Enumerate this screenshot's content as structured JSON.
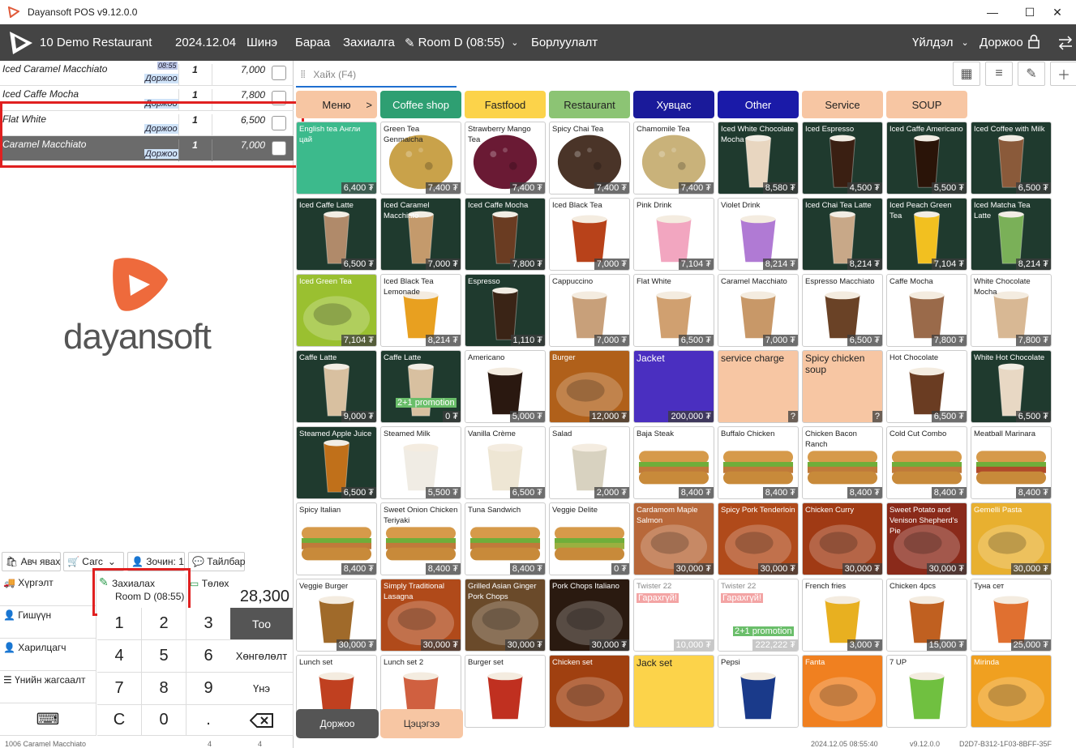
{
  "window": {
    "title": "Dayansoft POS v9.12.0.0"
  },
  "appbar": {
    "restaurant": "10 Demo Restaurant",
    "date": "2024.12.04",
    "new": "Шинэ",
    "goods": "Бараа",
    "orders": "Захиалга",
    "room": "Room D (08:55)",
    "sales": "Борлуулалт",
    "operations": "Үйлдэл",
    "template": "Доржоо"
  },
  "order_lines": [
    {
      "name": "Iced Caramel Macchiato",
      "time": "08:55",
      "staff": "Доржоо",
      "qty": "1",
      "price": "7,000"
    },
    {
      "name": "Iced Caffe Mocha",
      "staff": "Доржоо",
      "qty": "1",
      "price": "7,800"
    },
    {
      "name": "Flat White",
      "staff": "Доржоо",
      "qty": "1",
      "price": "6,500"
    },
    {
      "name": "Caramel Macchiato",
      "staff": "Доржоо",
      "qty": "1",
      "price": "7,000"
    }
  ],
  "brand": {
    "wordmark": "dayansoft"
  },
  "actions": {
    "takeaway": "Авч явах",
    "table": "Сагс",
    "guests": "Зочин: 1",
    "note": "Тайлбар"
  },
  "panel": {
    "delivery": "Хүргэлт",
    "order": "Захиалах",
    "order_room": "Room D (08:55)",
    "payment": "Төлөх",
    "total": "28,300",
    "member": "Гишүүн",
    "customer": "Харилцагч",
    "price_discount": "Үнийн жагсаалт",
    "qty": "Тоо",
    "discount": "Хөнгөлөлт",
    "price": "Үнэ"
  },
  "keypad": [
    "1",
    "2",
    "3",
    "4",
    "5",
    "6",
    "7",
    "8",
    "9",
    "C",
    "0",
    "."
  ],
  "search": {
    "placeholder": "Хайх (F4)"
  },
  "categories": [
    {
      "label": "Меню",
      "color": "#f7c6a3"
    },
    {
      "label": "Coffee shop",
      "color": "#2e9f72"
    },
    {
      "label": "Fastfood",
      "color": "#fcd34a"
    },
    {
      "label": "Restaurant",
      "color": "#8cc474"
    },
    {
      "label": "Хувцас",
      "color": "#1a1a9a"
    },
    {
      "label": "Other",
      "color": "#1a1aa8"
    },
    {
      "label": "Service",
      "color": "#f7c6a3"
    },
    {
      "label": "SOUP",
      "color": "#f7c6a3"
    }
  ],
  "tiles": [
    [
      {
        "name": "English tea Англи цай",
        "price": "6,400 ₮",
        "bg": "#3cba8c",
        "kind": "solid"
      },
      {
        "name": "Green Tea Genmaicha",
        "price": "7,400 ₮",
        "bg": "#c9a24a",
        "kind": "tea"
      },
      {
        "name": "Strawberry Mango Tea",
        "price": "7,400 ₮",
        "bg": "#6a1a34",
        "kind": "tea"
      },
      {
        "name": "Spicy Chai Tea",
        "price": "7,400 ₮",
        "bg": "#4a3428",
        "kind": "tea"
      },
      {
        "name": "Chamomile Tea",
        "price": "7,400 ₮",
        "bg": "#c9b27a",
        "kind": "tea"
      },
      {
        "name": "Iced White Chocolate Mocha",
        "price": "8,580 ₮",
        "bg": "#e8d6c0",
        "kind": "iced"
      },
      {
        "name": "Iced Espresso",
        "price": "4,500 ₮",
        "bg": "#3a1f12",
        "kind": "iced"
      },
      {
        "name": "Iced Caffe Americano",
        "price": "5,500 ₮",
        "bg": "#2a1408",
        "kind": "iced"
      },
      {
        "name": "Iced Coffee with Milk",
        "price": "6,500 ₮",
        "bg": "#8a5a3a",
        "kind": "iced"
      }
    ],
    [
      {
        "name": "Iced Caffe Latte",
        "price": "6,500 ₮",
        "bg": "#b08a6a",
        "kind": "iced"
      },
      {
        "name": "Iced Caramel Macchiato",
        "price": "7,000 ₮",
        "bg": "#c49a6c",
        "kind": "iced"
      },
      {
        "name": "Iced Caffe Mocha",
        "price": "7,800 ₮",
        "bg": "#6a3c22",
        "kind": "iced"
      },
      {
        "name": "Iced Black Tea",
        "price": "7,000 ₮",
        "bg": "#b8421a",
        "kind": "white"
      },
      {
        "name": "Pink Drink",
        "price": "7,104 ₮",
        "bg": "#f2a6c0",
        "kind": "white"
      },
      {
        "name": "Violet Drink",
        "price": "8,214 ₮",
        "bg": "#b07ad4",
        "kind": "white"
      },
      {
        "name": "Iced Chai Tea Latte",
        "price": "8,214 ₮",
        "bg": "#c8a888",
        "kind": "iced"
      },
      {
        "name": "Iced Peach Green Tea",
        "price": "7,104 ₮",
        "bg": "#f2c020",
        "kind": "iced"
      },
      {
        "name": "Iced Matcha Tea Latte",
        "price": "8,214 ₮",
        "bg": "#7ab058",
        "kind": "iced"
      }
    ],
    [
      {
        "name": "Iced Green Tea",
        "price": "7,104 ₮",
        "bg": "#9ac030",
        "kind": "photo"
      },
      {
        "name": "Iced Black Tea Lemonade",
        "price": "8,214 ₮",
        "bg": "#e8a020",
        "kind": "white"
      },
      {
        "name": "Espresso",
        "price": "1,110 ₮",
        "bg": "#3a2416",
        "kind": "iced"
      },
      {
        "name": "Cappuccino",
        "price": "7,000 ₮",
        "bg": "#c8a07a",
        "kind": "white"
      },
      {
        "name": "Flat White",
        "price": "6,500 ₮",
        "bg": "#d0a070",
        "kind": "white"
      },
      {
        "name": "Caramel Macchiato",
        "price": "7,000 ₮",
        "bg": "#c89868",
        "kind": "white"
      },
      {
        "name": "Espresso Macchiato",
        "price": "6,500 ₮",
        "bg": "#6a4226",
        "kind": "white"
      },
      {
        "name": "Caffe Mocha",
        "price": "7,800 ₮",
        "bg": "#9a6a4a",
        "kind": "white"
      },
      {
        "name": "White Chocolate Mocha",
        "price": "7,800 ₮",
        "bg": "#d8b894",
        "kind": "white"
      }
    ],
    [
      {
        "name": "Caffe Latte",
        "price": "9,000 ₮",
        "bg": "#d8c0a0",
        "kind": "iced"
      },
      {
        "name": "Caffe Latte",
        "price": "0 ₮",
        "bg": "#d8c0a0",
        "kind": "iced",
        "promo": "2+1 promotion"
      },
      {
        "name": "Americano",
        "price": "5,000 ₮",
        "bg": "#2a1810",
        "kind": "white"
      },
      {
        "name": "Burger",
        "price": "12,000 ₮",
        "bg": "#b0601a",
        "kind": "photo"
      },
      {
        "name": "Jacket",
        "price": "200,000 ₮",
        "bg": "#4a2fc0",
        "kind": "solid",
        "big": true
      },
      {
        "name": "service charge",
        "price": "?",
        "bg": "#f7c6a3",
        "kind": "solid",
        "big": true,
        "dark": true
      },
      {
        "name": "Spicy chicken soup",
        "price": "?",
        "bg": "#f7c6a3",
        "kind": "solid",
        "big": true,
        "dark": true
      },
      {
        "name": "Hot Chocolate",
        "price": "6,500 ₮",
        "bg": "#6a3c22",
        "kind": "white"
      },
      {
        "name": "White Hot Chocolate",
        "price": "6,500 ₮",
        "bg": "#e8d8c4",
        "kind": "iced"
      }
    ],
    [
      {
        "name": "Steamed Apple Juice",
        "price": "6,500 ₮",
        "bg": "#c0701a",
        "kind": "iced"
      },
      {
        "name": "Steamed Milk",
        "price": "5,500 ₮",
        "bg": "#f0ece4",
        "kind": "white"
      },
      {
        "name": "Vanilla Crème",
        "price": "6,500 ₮",
        "bg": "#eee6d4",
        "kind": "white"
      },
      {
        "name": "Salad",
        "price": "2,000 ₮",
        "bg": "#d8d2c0",
        "kind": "white"
      },
      {
        "name": "Baja Steak",
        "price": "8,400 ₮",
        "bg": "#c07a3a",
        "kind": "sandwich"
      },
      {
        "name": "Buffalo Chicken",
        "price": "8,400 ₮",
        "bg": "#c07a3a",
        "kind": "sandwich"
      },
      {
        "name": "Chicken Bacon Ranch",
        "price": "8,400 ₮",
        "bg": "#c07a3a",
        "kind": "sandwich"
      },
      {
        "name": "Cold Cut Combo",
        "price": "8,400 ₮",
        "bg": "#c07a3a",
        "kind": "sandwich"
      },
      {
        "name": "Meatball Marinara",
        "price": "8,400 ₮",
        "bg": "#b04a2a",
        "kind": "sandwich"
      }
    ],
    [
      {
        "name": "Spicy Italian",
        "price": "8,400 ₮",
        "bg": "#c07a3a",
        "kind": "sandwich"
      },
      {
        "name": "Sweet Onion Chicken Teriyaki",
        "price": "8,400 ₮",
        "bg": "#c07a3a",
        "kind": "sandwich"
      },
      {
        "name": "Tuna Sandwich",
        "price": "8,400 ₮",
        "bg": "#c07a3a",
        "kind": "sandwich"
      },
      {
        "name": "Veggie Delite",
        "price": "0 ₮",
        "bg": "#9ab040",
        "kind": "sandwich"
      },
      {
        "name": "Cardamom Maple Salmon",
        "price": "30,000 ₮",
        "bg": "#b8683a",
        "kind": "photo"
      },
      {
        "name": "Spicy Pork Tenderloin",
        "price": "30,000 ₮",
        "bg": "#b04a1a",
        "kind": "photo"
      },
      {
        "name": "Chicken Curry",
        "price": "30,000 ₮",
        "bg": "#a03a14",
        "kind": "photo"
      },
      {
        "name": "Sweet Potato and Venison Shepherd's Pie",
        "price": "30,000 ₮",
        "bg": "#8a2a1a",
        "kind": "photo"
      },
      {
        "name": "Gemelli Pasta",
        "price": "30,000 ₮",
        "bg": "#e8b030",
        "kind": "photo"
      }
    ],
    [
      {
        "name": "Veggie Burger",
        "price": "30,000 ₮",
        "bg": "#a06a2a",
        "kind": "white"
      },
      {
        "name": "Simply Traditional Lasagna",
        "price": "30,000 ₮",
        "bg": "#b04a1a",
        "kind": "photo"
      },
      {
        "name": "Grilled Asian Ginger Pork Chops",
        "price": "30,000 ₮",
        "bg": "#6a4a2a",
        "kind": "photo"
      },
      {
        "name": "Pork Chops Italiano",
        "price": "30,000 ₮",
        "bg": "#2a1a10",
        "kind": "photo"
      },
      {
        "name": "Twister 22",
        "price": "10,000 ₮",
        "bg": "#ffffff",
        "kind": "blank",
        "badge": "Гарахгүй!"
      },
      {
        "name": "Twister 22",
        "price": "222,222 ₮",
        "bg": "#ffffff",
        "kind": "blank",
        "badge": "Гарахгүй!",
        "promo": "2+1 promotion"
      },
      {
        "name": "French fries",
        "price": "3,000 ₮",
        "bg": "#e8b020",
        "kind": "white"
      },
      {
        "name": "Chicken 4pcs",
        "price": "15,000 ₮",
        "bg": "#c06020",
        "kind": "white"
      },
      {
        "name": "Туна сет",
        "price": "25,000 ₮",
        "bg": "#e07030",
        "kind": "white"
      }
    ],
    [
      {
        "name": "Lunch set",
        "price": "",
        "bg": "#c04020",
        "kind": "white"
      },
      {
        "name": "Lunch set 2",
        "price": "",
        "bg": "#d06040",
        "kind": "white"
      },
      {
        "name": "Burger set",
        "price": "",
        "bg": "#c03020",
        "kind": "white"
      },
      {
        "name": "Chicken set",
        "price": "",
        "bg": "#a04010",
        "kind": "photo"
      },
      {
        "name": "Jack set",
        "price": "",
        "bg": "#fcd34a",
        "kind": "solid",
        "big": true,
        "dark": true
      },
      {
        "name": "Pepsi",
        "price": "",
        "bg": "#1a3a8a",
        "kind": "white"
      },
      {
        "name": "Fanta",
        "price": "",
        "bg": "#f08020",
        "kind": "photo"
      },
      {
        "name": "7 UP",
        "price": "",
        "bg": "#70c040",
        "kind": "white"
      },
      {
        "name": "Mirinda",
        "price": "",
        "bg": "#f0a020",
        "kind": "photo"
      }
    ]
  ],
  "bottom_buttons": {
    "staff": "Доржоо",
    "chef": "Цэцэгээ"
  },
  "status": {
    "left": "1006 Caramel Macchiato",
    "mid1": "4",
    "mid2": "4",
    "time": "2024.12.05 08:55:40",
    "version": "v9.12.0.0",
    "id": "D2D7-B312-1F03-8BFF-35F"
  }
}
